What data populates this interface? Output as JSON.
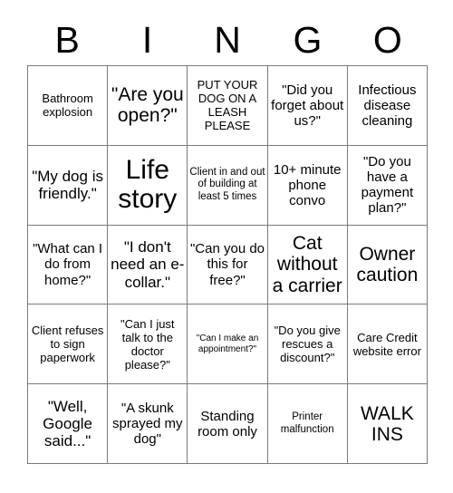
{
  "header": {
    "letters": [
      "B",
      "I",
      "N",
      "G",
      "O"
    ]
  },
  "grid": {
    "rows": [
      [
        {
          "text": "Bathroom explosion",
          "size": "fs-m"
        },
        {
          "text": "\"Are you open?\"",
          "size": "fs-xxl"
        },
        {
          "text": "PUT YOUR DOG ON A LEASH PLEASE",
          "size": "fs-m"
        },
        {
          "text": "\"Did you forget about us?\"",
          "size": "fs-l"
        },
        {
          "text": "Infectious disease cleaning",
          "size": "fs-l"
        }
      ],
      [
        {
          "text": "\"My dog is friendly.\"",
          "size": "fs-xl"
        },
        {
          "text": "Life story",
          "size": "fs-huge"
        },
        {
          "text": "Client in and out of building at least 5 times",
          "size": "fs-s"
        },
        {
          "text": "10+ minute phone convo",
          "size": "fs-l"
        },
        {
          "text": "\"Do you have a payment plan?\"",
          "size": "fs-l"
        }
      ],
      [
        {
          "text": "\"What can I do from home?\"",
          "size": "fs-l"
        },
        {
          "text": "\"I don't need an e-collar.\"",
          "size": "fs-xl"
        },
        {
          "text": "\"Can you do this for free?\"",
          "size": "fs-l"
        },
        {
          "text": "Cat without a carrier",
          "size": "fs-xxl"
        },
        {
          "text": "Owner caution",
          "size": "fs-xxl"
        }
      ],
      [
        {
          "text": "Client refuses to sign paperwork",
          "size": "fs-m"
        },
        {
          "text": "\"Can I just talk to the doctor please?\"",
          "size": "fs-m"
        },
        {
          "text": "\"Can I make an appointment?\"",
          "size": "fs-xs"
        },
        {
          "text": "\"Do you give rescues a discount?\"",
          "size": "fs-m"
        },
        {
          "text": "Care Credit website error",
          "size": "fs-m"
        }
      ],
      [
        {
          "text": "\"Well, Google said...\"",
          "size": "fs-xl"
        },
        {
          "text": "\"A skunk sprayed my dog\"",
          "size": "fs-l"
        },
        {
          "text": "Standing room only",
          "size": "fs-l"
        },
        {
          "text": "Printer malfunction",
          "size": "fs-s"
        },
        {
          "text": "WALK INS",
          "size": "fs-xxl"
        }
      ]
    ]
  },
  "colors": {
    "background": "#ffffff",
    "text": "#000000",
    "grid_line": "#7b7b7b"
  }
}
